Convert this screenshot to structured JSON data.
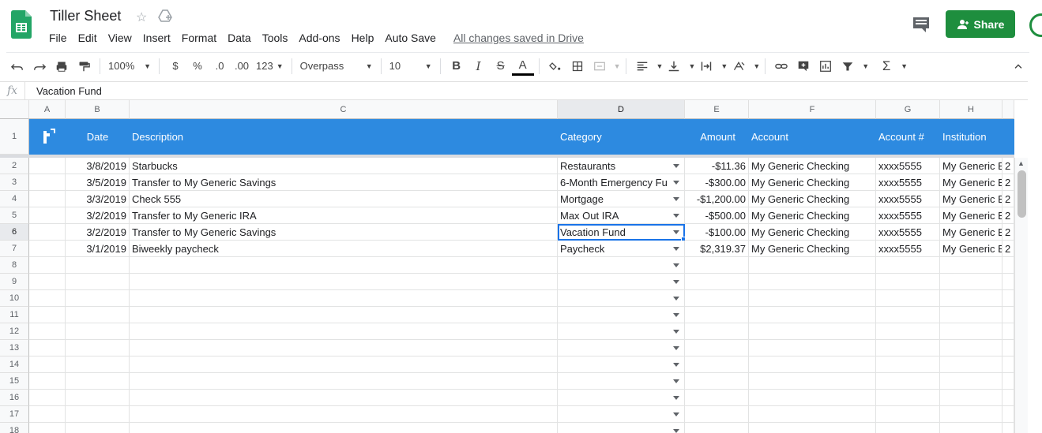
{
  "app": {
    "title": "Tiller Sheet",
    "share_label": "Share",
    "saved_status": "All changes saved in Drive",
    "colors": {
      "brand_green": "#1e8e3e",
      "header_blue": "#2d8ae0",
      "selection_blue": "#1a73e8"
    }
  },
  "menu": [
    "File",
    "Edit",
    "View",
    "Insert",
    "Format",
    "Data",
    "Tools",
    "Add-ons",
    "Help",
    "Auto Save"
  ],
  "toolbar": {
    "zoom": "100%",
    "currency": "$",
    "percent": "%",
    "decrease_decimal": ".0",
    "increase_decimal": ".00",
    "number_format": "123",
    "font": "Overpass",
    "font_size": "10",
    "bold": "B",
    "italic": "I",
    "strike": "S",
    "text_color": "A",
    "sum": "Σ",
    "icons": [
      "undo-icon",
      "redo-icon",
      "print-icon",
      "paint-format-icon",
      "fill-color-icon",
      "borders-icon",
      "merge-icon",
      "align-left-icon",
      "valign-bottom-icon",
      "text-wrap-icon",
      "text-rotate-icon",
      "link-icon",
      "comment-add-icon",
      "chart-icon",
      "filter-icon",
      "collapse-icon"
    ]
  },
  "formula_bar": {
    "fx": "fx",
    "value": "Vacation Fund"
  },
  "columns": [
    "A",
    "B",
    "C",
    "D",
    "E",
    "F",
    "G",
    "H"
  ],
  "header_row": {
    "row_number": "1",
    "date": "Date",
    "description": "Description",
    "category": "Category",
    "amount": "Amount",
    "account": "Account",
    "account_num": "Account #",
    "institution": "Institution"
  },
  "rows": [
    {
      "num": "2",
      "date": "3/8/2019",
      "description": "Starbucks",
      "category": "Restaurants",
      "amount": "-$11.36",
      "account": "My Generic Checking",
      "account_num": "xxxx5555",
      "institution": "My Generic B",
      "extra": "2"
    },
    {
      "num": "3",
      "date": "3/5/2019",
      "description": "Transfer to My Generic Savings",
      "category": "6-Month Emergency Fu",
      "amount": "-$300.00",
      "account": "My Generic Checking",
      "account_num": "xxxx5555",
      "institution": "My Generic B",
      "extra": "2"
    },
    {
      "num": "4",
      "date": "3/3/2019",
      "description": "Check 555",
      "category": "Mortgage",
      "amount": "-$1,200.00",
      "account": "My Generic Checking",
      "account_num": "xxxx5555",
      "institution": "My Generic B",
      "extra": "2"
    },
    {
      "num": "5",
      "date": "3/2/2019",
      "description": "Transfer to My Generic IRA",
      "category": "Max Out IRA",
      "amount": "-$500.00",
      "account": "My Generic Checking",
      "account_num": "xxxx5555",
      "institution": "My Generic B",
      "extra": "2"
    },
    {
      "num": "6",
      "date": "3/2/2019",
      "description": "Transfer to My Generic Savings",
      "category": "Vacation Fund",
      "amount": "-$100.00",
      "account": "My Generic Checking",
      "account_num": "xxxx5555",
      "institution": "My Generic B",
      "extra": "2"
    },
    {
      "num": "7",
      "date": "3/1/2019",
      "description": "Biweekly paycheck",
      "category": "Paycheck",
      "amount": "$2,319.37",
      "account": "My Generic Checking",
      "account_num": "xxxx5555",
      "institution": "My Generic B",
      "extra": "2"
    }
  ],
  "empty_rows": [
    "8",
    "9",
    "10",
    "11",
    "12",
    "13",
    "14",
    "15",
    "16",
    "17",
    "18"
  ],
  "selected_cell": "D6"
}
